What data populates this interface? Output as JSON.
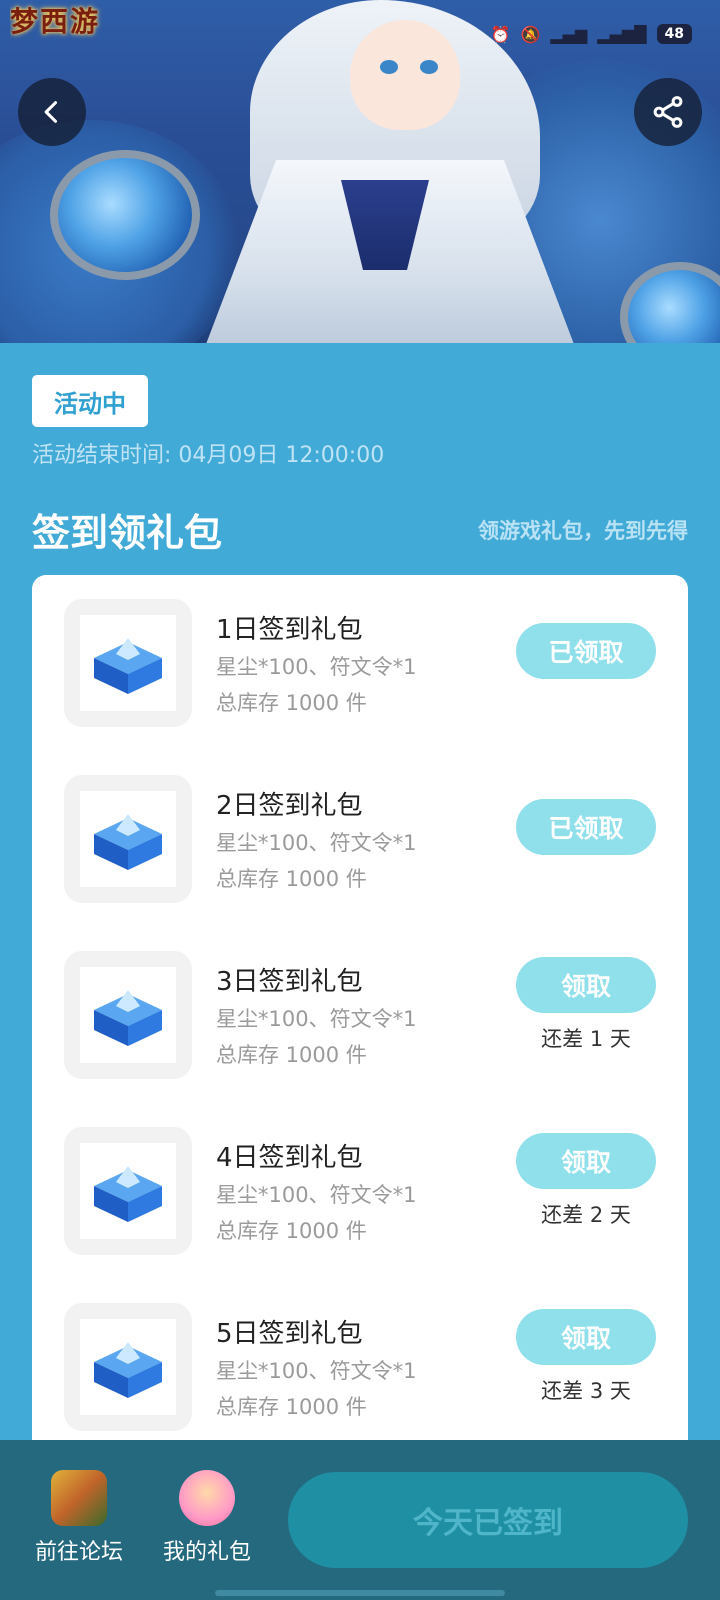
{
  "header": {
    "game_logo_text": "梦西游",
    "battery": "48",
    "status_icons": [
      "alarm-icon",
      "mute-icon",
      "hd-icon",
      "signal-4g-icon",
      "signal-5g-icon"
    ]
  },
  "activity": {
    "status_badge": "活动中",
    "end_time": "活动结束时间: 04月09日 12:00:00"
  },
  "section": {
    "title": "签到领礼包",
    "subtitle": "领游戏礼包，先到先得"
  },
  "gifts": [
    {
      "name": "1日签到礼包",
      "desc": "星尘*100、符文令*1",
      "stock": "总库存 1000 件",
      "button": "已领取",
      "remain": ""
    },
    {
      "name": "2日签到礼包",
      "desc": "星尘*100、符文令*1",
      "stock": "总库存 1000 件",
      "button": "已领取",
      "remain": ""
    },
    {
      "name": "3日签到礼包",
      "desc": "星尘*100、符文令*1",
      "stock": "总库存 1000 件",
      "button": "领取",
      "remain": "还差 1 天"
    },
    {
      "name": "4日签到礼包",
      "desc": "星尘*100、符文令*1",
      "stock": "总库存 1000 件",
      "button": "领取",
      "remain": "还差 2 天"
    },
    {
      "name": "5日签到礼包",
      "desc": "星尘*100、符文令*1",
      "stock": "总库存 1000 件",
      "button": "领取",
      "remain": "还差 3 天"
    }
  ],
  "bottom": {
    "forum_label": "前往论坛",
    "my_gifts_label": "我的礼包",
    "signed_label": "今天已签到"
  },
  "colors": {
    "page_bg": "#41aad6",
    "claim_button": "#8fe0ea",
    "bottom_bar": "#25697f",
    "signed_button": "#1f8fa3"
  }
}
